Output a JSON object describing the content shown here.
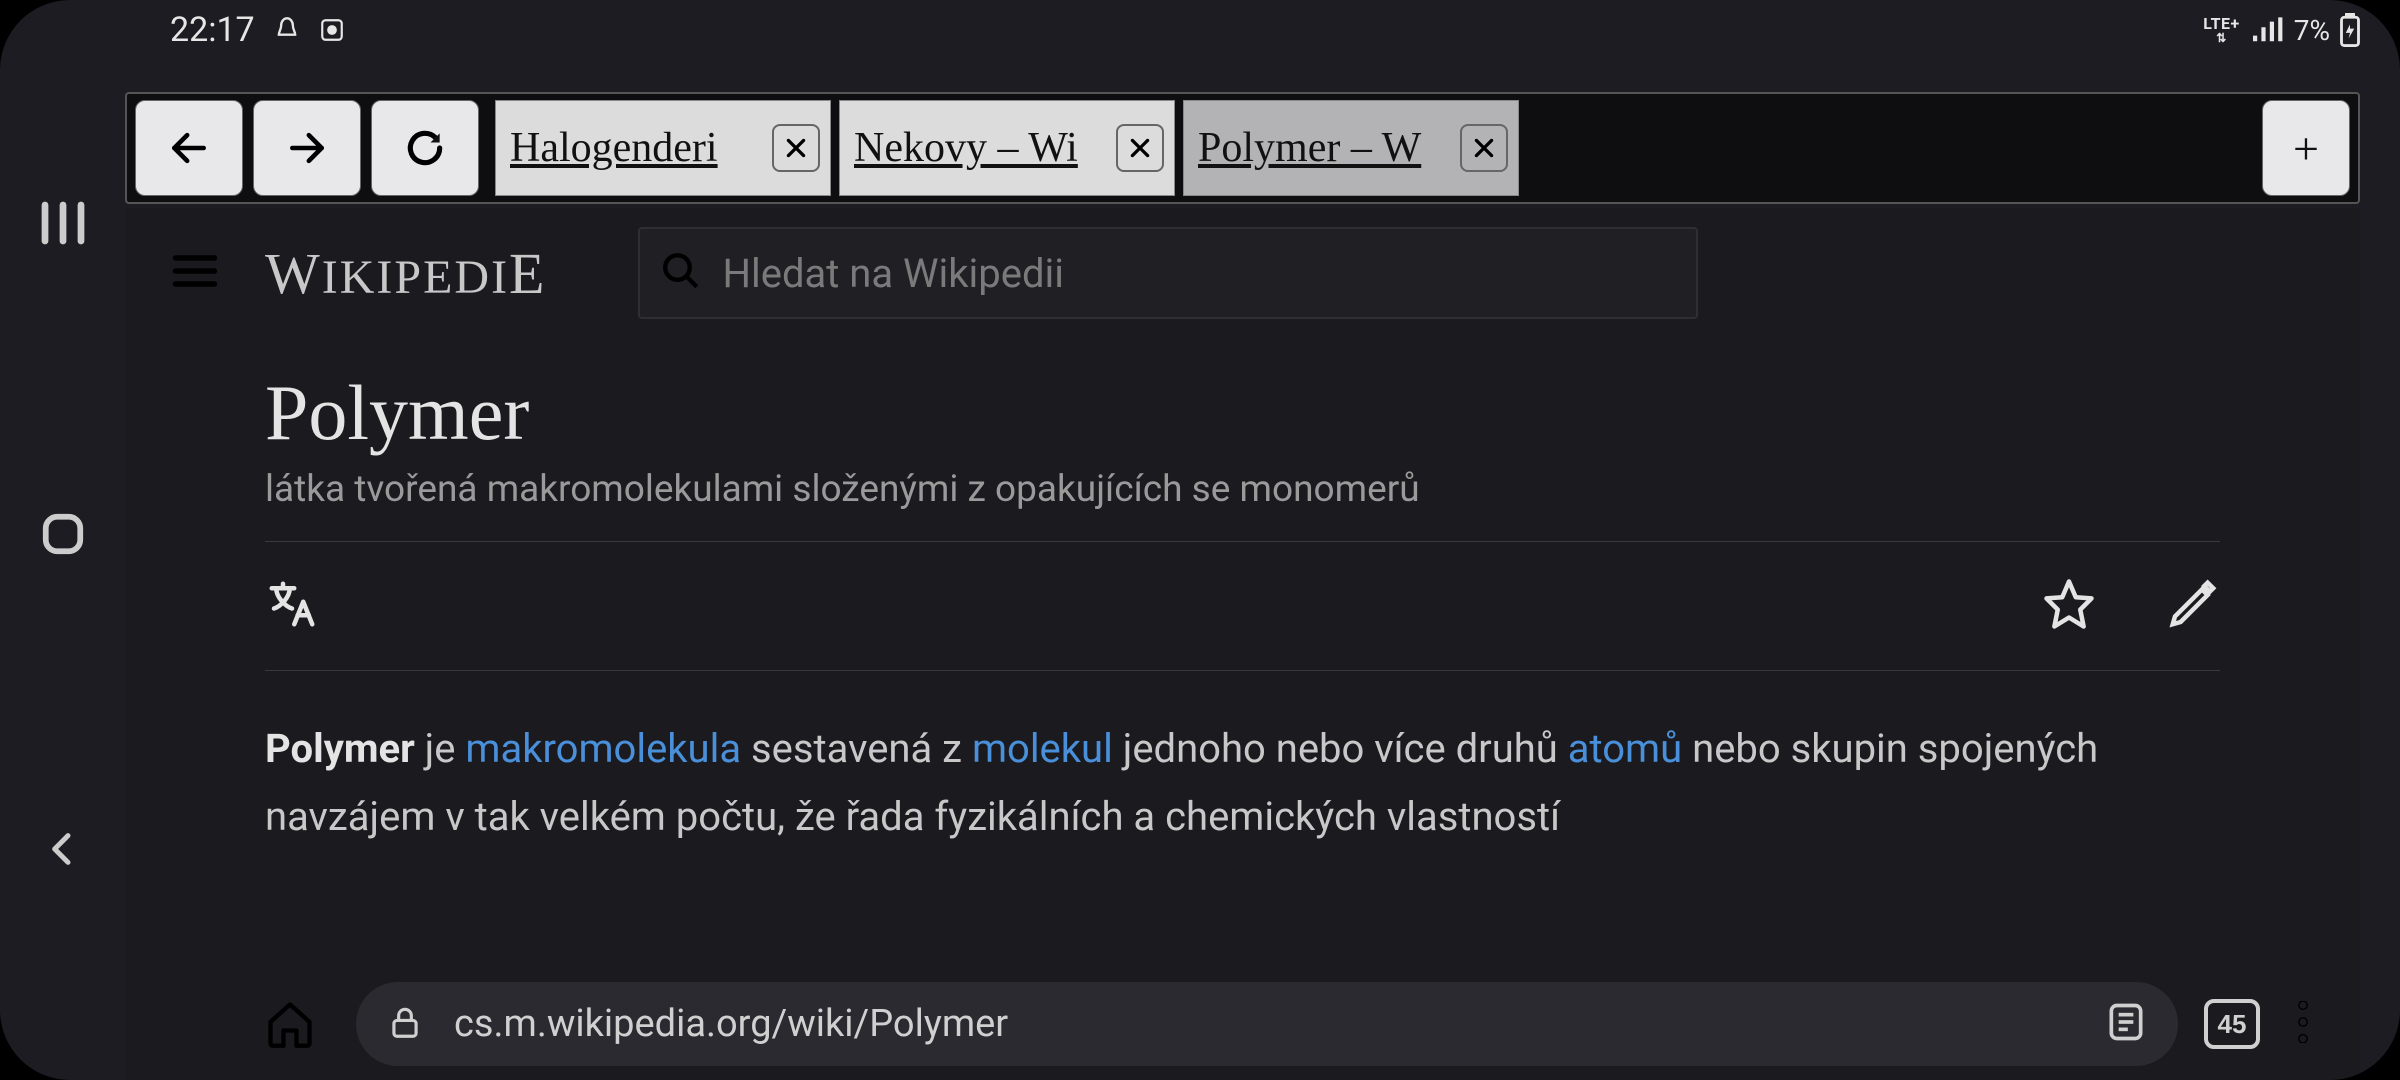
{
  "statusbar": {
    "time": "22:17",
    "network_label": "LTE+",
    "battery_pct": "7%"
  },
  "browser": {
    "tabs": [
      {
        "title": "Halogenderi"
      },
      {
        "title": "Nekovy – Wi"
      },
      {
        "title": "Polymer – W"
      }
    ],
    "active_tab_index": 2,
    "tab_count": "45",
    "url": "cs.m.wikipedia.org/wiki/Polymer"
  },
  "wiki": {
    "logo_text": "WIKIPEDIE",
    "search_placeholder": "Hledat na Wikipedii",
    "article": {
      "title": "Polymer",
      "subtitle": "látka tvořená makromolekulami složenými z opakujících se monomerů",
      "body_bold": "Polymer",
      "body_seg1": " je ",
      "body_link1": "makromolekula",
      "body_seg2": " sestavená z ",
      "body_link2": "molekul",
      "body_seg3": " jednoho nebo více druhů ",
      "body_link3": "atomů",
      "body_seg4": " nebo skupin spojených navzájem v tak velkém počtu, že řada fyzikálních a chemických vlastností"
    }
  }
}
